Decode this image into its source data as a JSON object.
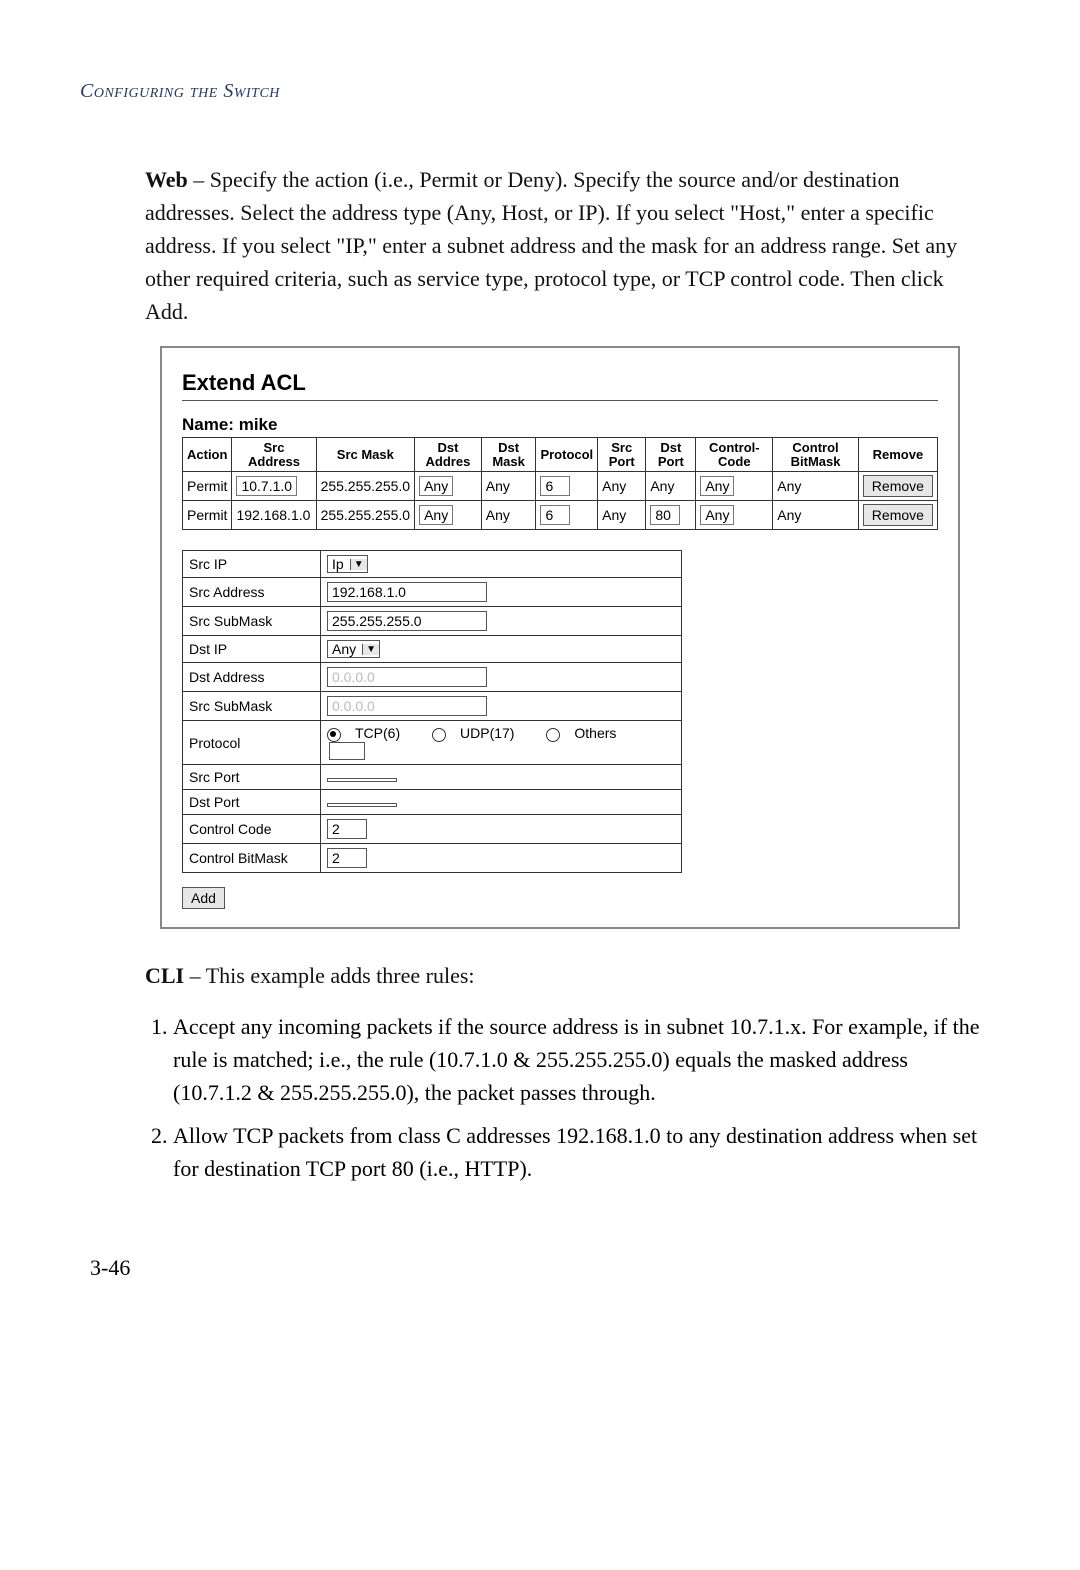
{
  "running_head": "Configuring the Switch",
  "intro": {
    "prefix": "Web",
    "text": " – Specify the action (i.e., Permit or Deny). Specify the source and/or destination addresses. Select the address type (Any, Host, or IP). If you select \"Host,\" enter a specific address. If you select \"IP,\" enter a subnet address and the mask for an address range. Set any other required criteria, such as service type, protocol type, or TCP control code. Then click Add."
  },
  "panel": {
    "title": "Extend ACL",
    "name_label": "Name:",
    "name_value": "mike",
    "headers": [
      "Action",
      "Src Address",
      "Src Mask",
      "Dst Addres",
      "Dst Mask",
      "Protocol",
      "Src Port",
      "Dst Port",
      "Control-Code",
      "Control BitMask",
      "Remove"
    ],
    "rows": [
      {
        "action": "Permit",
        "src_addr": "10.7.1.0",
        "src_mask": "255.255.255.0",
        "dst_addr": "Any",
        "dst_mask": "Any",
        "protocol": "6",
        "src_port": "Any",
        "dst_port": "Any",
        "ccode": "Any",
        "cbitmask": "Any",
        "remove": "Remove"
      },
      {
        "action": "Permit",
        "src_addr": "192.168.1.0",
        "src_mask": "255.255.255.0",
        "dst_addr": "Any",
        "dst_mask": "Any",
        "protocol": "6",
        "src_port": "Any",
        "dst_port": "80",
        "ccode": "Any",
        "cbitmask": "Any",
        "remove": "Remove"
      }
    ],
    "form": {
      "src_ip_label": "Src IP",
      "src_ip_value": "Ip",
      "src_addr_label": "Src Address",
      "src_addr_value": "192.168.1.0",
      "src_submask_label": "Src SubMask",
      "src_submask_value": "255.255.255.0",
      "dst_ip_label": "Dst IP",
      "dst_ip_value": "Any",
      "dst_addr_label": "Dst Address",
      "dst_addr_value": "0.0.0.0",
      "dst_submask_label": "Src SubMask",
      "dst_submask_value": "0.0.0.0",
      "protocol_label": "Protocol",
      "protocol_options": {
        "tcp": "TCP(6)",
        "udp": "UDP(17)",
        "others": "Others"
      },
      "protocol_selected": "tcp",
      "src_port_label": "Src Port",
      "src_port_value": "",
      "dst_port_label": "Dst Port",
      "dst_port_value": "",
      "ccode_label": "Control Code",
      "ccode_value": "2",
      "cbitmask_label": "Control BitMask",
      "cbitmask_value": "2",
      "add_label": "Add"
    }
  },
  "cli_intro": {
    "prefix": "CLI",
    "text": " – This example adds three rules:"
  },
  "rules": [
    "Accept any incoming packets if the source address is in subnet 10.7.1.x. For example, if the rule is matched; i.e., the rule (10.7.1.0 & 255.255.255.0) equals the masked address (10.7.1.2 & 255.255.255.0), the packet passes through.",
    "Allow TCP packets from class C addresses 192.168.1.0 to any destination address when set for destination TCP port 80 (i.e., HTTP)."
  ],
  "page_number": "3-46"
}
